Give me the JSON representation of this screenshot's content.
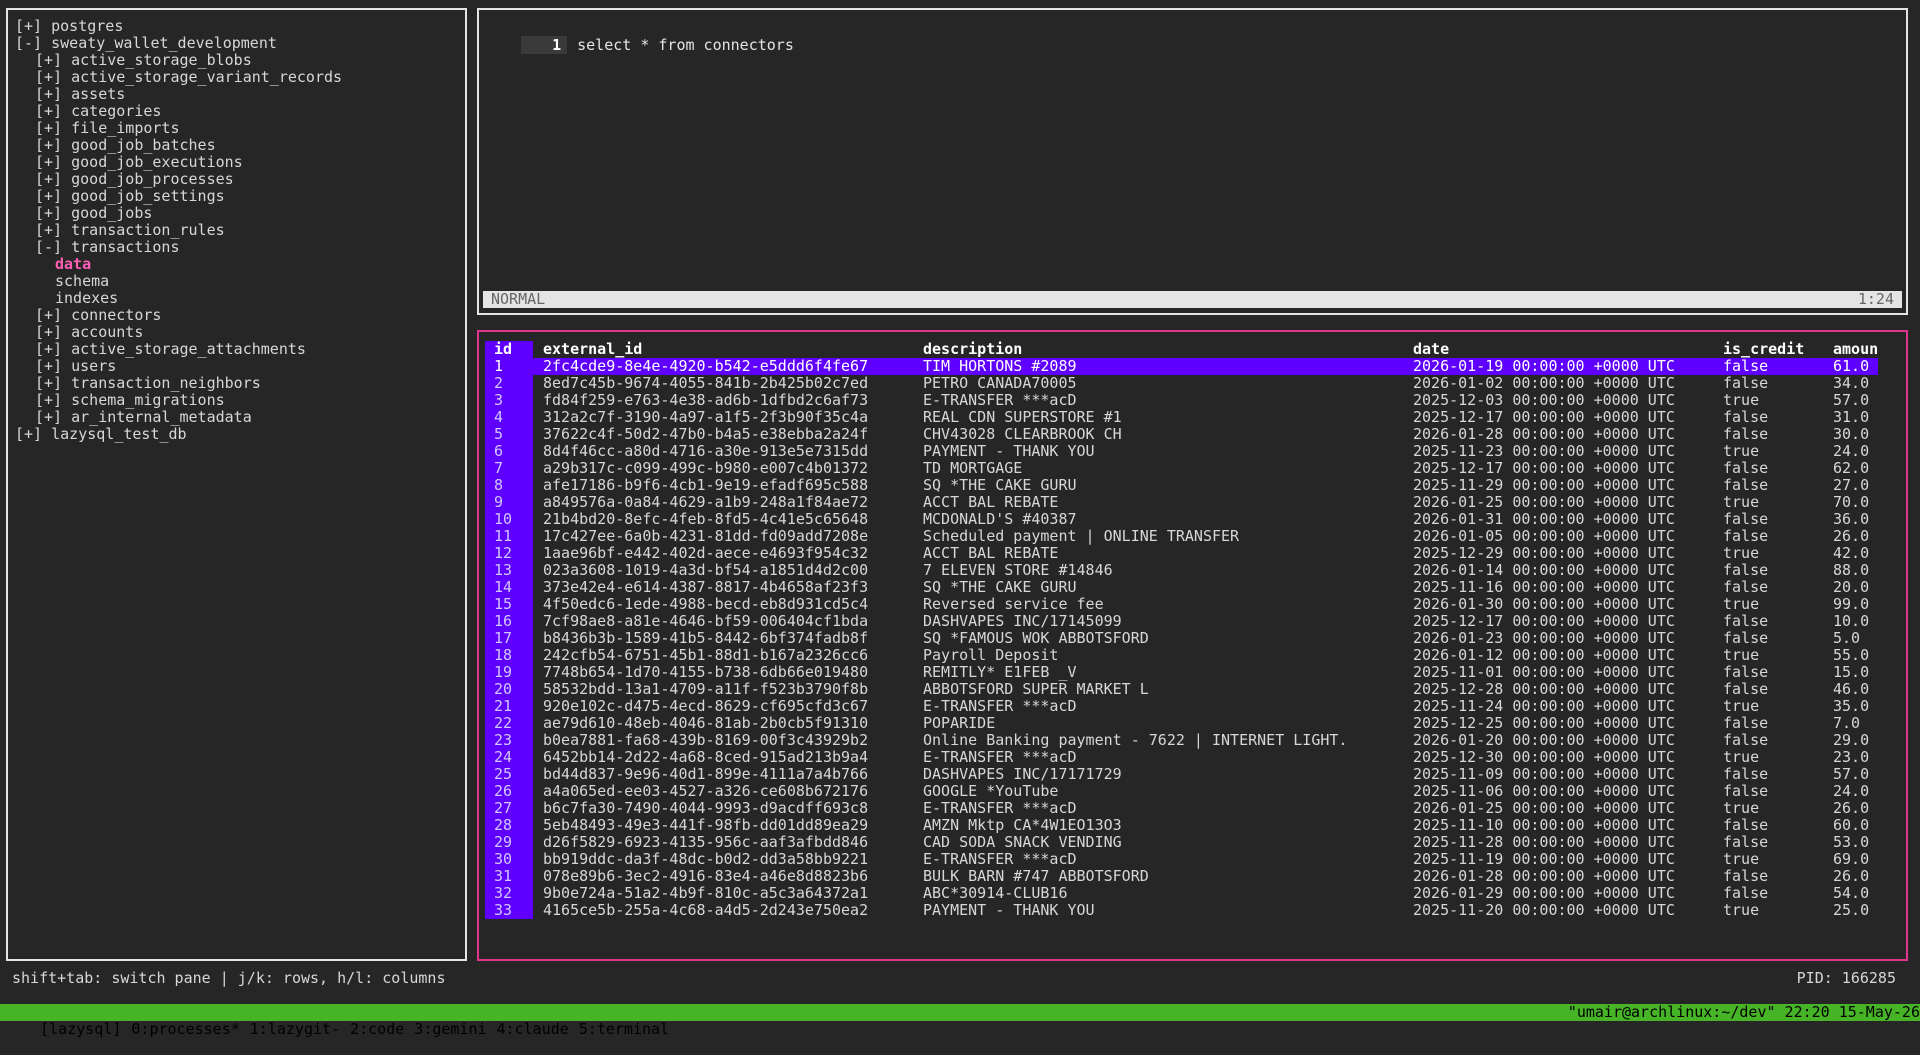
{
  "tree": {
    "items": [
      {
        "depth": 0,
        "label": "[+] postgres"
      },
      {
        "depth": 0,
        "label": "[-] sweaty_wallet_development"
      },
      {
        "depth": 1,
        "label": "[+] active_storage_blobs"
      },
      {
        "depth": 1,
        "label": "[+] active_storage_variant_records"
      },
      {
        "depth": 1,
        "label": "[+] assets"
      },
      {
        "depth": 1,
        "label": "[+] categories"
      },
      {
        "depth": 1,
        "label": "[+] file_imports"
      },
      {
        "depth": 1,
        "label": "[+] good_job_batches"
      },
      {
        "depth": 1,
        "label": "[+] good_job_executions"
      },
      {
        "depth": 1,
        "label": "[+] good_job_processes"
      },
      {
        "depth": 1,
        "label": "[+] good_job_settings"
      },
      {
        "depth": 1,
        "label": "[+] good_jobs"
      },
      {
        "depth": 1,
        "label": "[+] transaction_rules"
      },
      {
        "depth": 1,
        "label": "[-] transactions"
      },
      {
        "depth": 2,
        "label": "data",
        "selected": true
      },
      {
        "depth": 2,
        "label": "schema"
      },
      {
        "depth": 2,
        "label": "indexes"
      },
      {
        "depth": 1,
        "label": "[+] connectors"
      },
      {
        "depth": 1,
        "label": "[+] accounts"
      },
      {
        "depth": 1,
        "label": "[+] active_storage_attachments"
      },
      {
        "depth": 1,
        "label": "[+] users"
      },
      {
        "depth": 1,
        "label": "[+] transaction_neighbors"
      },
      {
        "depth": 1,
        "label": "[+] schema_migrations"
      },
      {
        "depth": 1,
        "label": "[+] ar_internal_metadata"
      },
      {
        "depth": 0,
        "label": "[+] lazysql_test_db"
      }
    ]
  },
  "editor": {
    "line_number": "1",
    "code": "select * from connectors",
    "mode": "NORMAL",
    "cursor_pos": "1:24"
  },
  "results": {
    "columns": [
      "id",
      "external_id",
      "description",
      "date",
      "is_credit",
      "amoun"
    ],
    "rows": [
      [
        "1",
        "2fc4cde9-8e4e-4920-b542-e5ddd6f4fe67",
        "TIM HORTONS #2089",
        "2026-01-19 00:00:00 +0000 UTC",
        "false",
        "61.0"
      ],
      [
        "2",
        "8ed7c45b-9674-4055-841b-2b425b02c7ed",
        "PETRO CANADA70005",
        "2026-01-02 00:00:00 +0000 UTC",
        "false",
        "34.0"
      ],
      [
        "3",
        "fd84f259-e763-4e38-ad6b-1dfbd2c6af73",
        "E-TRANSFER ***acD",
        "2025-12-03 00:00:00 +0000 UTC",
        "true",
        "57.0"
      ],
      [
        "4",
        "312a2c7f-3190-4a97-a1f5-2f3b90f35c4a",
        "REAL CDN SUPERSTORE #1",
        "2025-12-17 00:00:00 +0000 UTC",
        "false",
        "31.0"
      ],
      [
        "5",
        "37622c4f-50d2-47b0-b4a5-e38ebba2a24f",
        "CHV43028 CLEARBROOK CH",
        "2026-01-28 00:00:00 +0000 UTC",
        "false",
        "30.0"
      ],
      [
        "6",
        "8d4f46cc-a80d-4716-a30e-913e5e7315dd",
        "PAYMENT - THANK YOU",
        "2025-11-23 00:00:00 +0000 UTC",
        "true",
        "24.0"
      ],
      [
        "7",
        "a29b317c-c099-499c-b980-e007c4b01372",
        "TD MORTGAGE",
        "2025-12-17 00:00:00 +0000 UTC",
        "false",
        "62.0"
      ],
      [
        "8",
        "afe17186-b9f6-4cb1-9e19-efadf695c588",
        "SQ *THE CAKE GURU",
        "2025-11-29 00:00:00 +0000 UTC",
        "false",
        "27.0"
      ],
      [
        "9",
        "a849576a-0a84-4629-a1b9-248a1f84ae72",
        "ACCT BAL REBATE",
        "2026-01-25 00:00:00 +0000 UTC",
        "true",
        "70.0"
      ],
      [
        "10",
        "21b4bd20-8efc-4feb-8fd5-4c41e5c65648",
        "MCDONALD'S #40387",
        "2026-01-31 00:00:00 +0000 UTC",
        "false",
        "36.0"
      ],
      [
        "11",
        "17c427ee-6a0b-4231-81dd-fd09add7208e",
        "Scheduled payment | ONLINE TRANSFER",
        "2026-01-05 00:00:00 +0000 UTC",
        "false",
        "26.0"
      ],
      [
        "12",
        "1aae96bf-e442-402d-aece-e4693f954c32",
        "ACCT BAL REBATE",
        "2025-12-29 00:00:00 +0000 UTC",
        "true",
        "42.0"
      ],
      [
        "13",
        "023a3608-1019-4a3d-bf54-a1851d4d2c00",
        "7 ELEVEN STORE #14846",
        "2026-01-14 00:00:00 +0000 UTC",
        "false",
        "88.0"
      ],
      [
        "14",
        "373e42e4-e614-4387-8817-4b4658af23f3",
        "SQ *THE CAKE GURU",
        "2025-11-16 00:00:00 +0000 UTC",
        "false",
        "20.0"
      ],
      [
        "15",
        "4f50edc6-1ede-4988-becd-eb8d931cd5c4",
        "Reversed service fee",
        "2026-01-30 00:00:00 +0000 UTC",
        "true",
        "99.0"
      ],
      [
        "16",
        "7cf98ae8-a81e-4646-bf59-006404cf1bda",
        "DASHVAPES INC/17145099",
        "2025-12-17 00:00:00 +0000 UTC",
        "false",
        "10.0"
      ],
      [
        "17",
        "b8436b3b-1589-41b5-8442-6bf374fadb8f",
        "SQ *FAMOUS WOK ABBOTSFORD",
        "2026-01-23 00:00:00 +0000 UTC",
        "false",
        "5.0"
      ],
      [
        "18",
        "242cfb54-6751-45b1-88d1-b167a2326cc6",
        "Payroll Deposit",
        "2026-01-12 00:00:00 +0000 UTC",
        "true",
        "55.0"
      ],
      [
        "19",
        "7748b654-1d70-4155-b738-6db66e019480",
        "REMITLY* E1FEB _V",
        "2025-11-01 00:00:00 +0000 UTC",
        "false",
        "15.0"
      ],
      [
        "20",
        "58532bdd-13a1-4709-a11f-f523b3790f8b",
        "ABBOTSFORD SUPER MARKET L",
        "2025-12-28 00:00:00 +0000 UTC",
        "false",
        "46.0"
      ],
      [
        "21",
        "920e102c-d475-4ecd-8629-cf695cfd3c67",
        "E-TRANSFER ***acD",
        "2025-11-24 00:00:00 +0000 UTC",
        "true",
        "35.0"
      ],
      [
        "22",
        "ae79d610-48eb-4046-81ab-2b0cb5f91310",
        "POPARIDE",
        "2025-12-25 00:00:00 +0000 UTC",
        "false",
        "7.0"
      ],
      [
        "23",
        "b0ea7881-fa68-439b-8169-00f3c43929b2",
        "Online Banking payment - 7622 | INTERNET LIGHT.",
        "2026-01-20 00:00:00 +0000 UTC",
        "false",
        "29.0"
      ],
      [
        "24",
        "6452bb14-2d22-4a68-8ced-915ad213b9a4",
        "E-TRANSFER ***acD",
        "2025-12-30 00:00:00 +0000 UTC",
        "true",
        "23.0"
      ],
      [
        "25",
        "bd44d837-9e96-40d1-899e-4111a7a4b766",
        "DASHVAPES INC/17171729",
        "2025-11-09 00:00:00 +0000 UTC",
        "false",
        "57.0"
      ],
      [
        "26",
        "a4a065ed-ee03-4527-a326-ce608b672176",
        "GOOGLE *YouTube",
        "2025-11-06 00:00:00 +0000 UTC",
        "false",
        "24.0"
      ],
      [
        "27",
        "b6c7fa30-7490-4044-9993-d9acdff693c8",
        "E-TRANSFER ***acD",
        "2026-01-25 00:00:00 +0000 UTC",
        "true",
        "26.0"
      ],
      [
        "28",
        "5eb48493-49e3-441f-98fb-dd01dd89ea29",
        "AMZN Mktp CA*4W1EO13O3",
        "2025-11-10 00:00:00 +0000 UTC",
        "false",
        "60.0"
      ],
      [
        "29",
        "d26f5829-6923-4135-956c-aaf3afbdd846",
        "CAD SODA SNACK VENDING",
        "2025-11-28 00:00:00 +0000 UTC",
        "false",
        "53.0"
      ],
      [
        "30",
        "bb919ddc-da3f-48dc-b0d2-dd3a58bb9221",
        "E-TRANSFER ***acD",
        "2025-11-19 00:00:00 +0000 UTC",
        "true",
        "69.0"
      ],
      [
        "31",
        "078e89b6-3ec2-4916-83e4-a46e8d8823b6",
        "BULK BARN #747 ABBOTSFORD",
        "2026-01-28 00:00:00 +0000 UTC",
        "false",
        "26.0"
      ],
      [
        "32",
        "9b0e724a-51a2-4b9f-810c-a5c3a64372a1",
        "ABC*30914-CLUB16",
        "2026-01-29 00:00:00 +0000 UTC",
        "false",
        "54.0"
      ],
      [
        "33",
        "4165ce5b-255a-4c68-a4d5-2d243e750ea2",
        "PAYMENT - THANK YOU",
        "2025-11-20 00:00:00 +0000 UTC",
        "true",
        "25.0"
      ]
    ]
  },
  "footer": {
    "help": "shift+tab: switch pane | j/k: rows, h/l: columns",
    "pid": "PID: 166285"
  },
  "tmux": {
    "session": "[lazysql]",
    "windows": [
      "0:processes*",
      "1:lazygit-",
      "2:code",
      "3:gemini",
      "4:claude",
      "5:terminal"
    ],
    "status_right": "\"umair@archlinux:~/dev\" 22:20 15-May-26"
  },
  "colors": {
    "background": "#262626",
    "border": "#e4e4e4",
    "results_border": "#e0358f",
    "selection": "#5f00ff",
    "tree_selected": "#ff5fb4",
    "tmux_bar": "#47b427"
  }
}
